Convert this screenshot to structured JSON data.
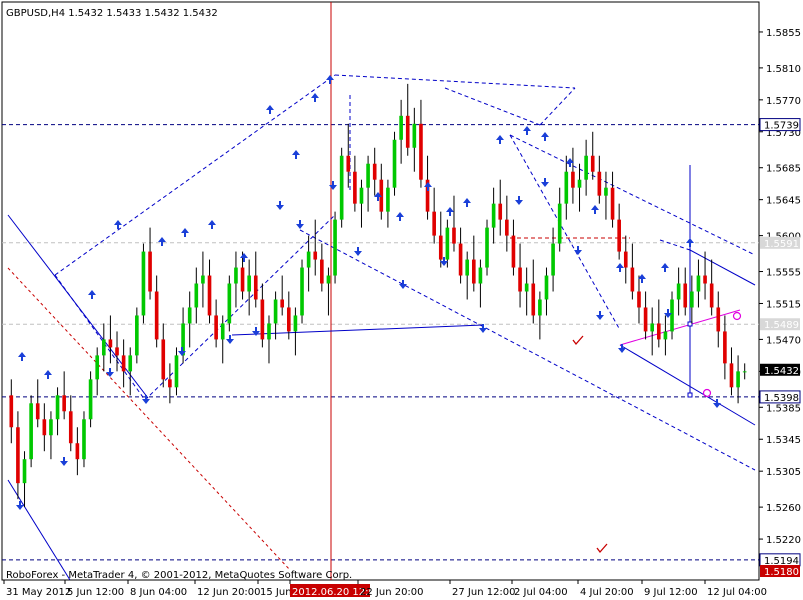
{
  "window": {
    "symbol_title": "GBPUSD,H4  1.5432 1.5433 1.5432 1.5432",
    "watermark": "RoboForex - MetaTrader 4, © 2001-2012, MetaQuotes Software Corp."
  },
  "colors": {
    "background": "#ffffff",
    "bull_candle": "#00c800",
    "bear_candle": "#e00000",
    "wick": "#000000",
    "trend_line": "#0000c8",
    "level_line": "#000080",
    "accent_red": "#c80000",
    "accent_magenta": "#e000e0",
    "axis_text": "#000000",
    "price_label_bg": "#000080"
  },
  "icons": [
    "arrow-up-icon",
    "arrow-down-icon",
    "checkmark-icon",
    "circle-marker-icon"
  ],
  "chart_data": {
    "type": "candlestick",
    "instrument": "GBPUSD",
    "timeframe": "H4",
    "current_price": 1.5432,
    "y_ticks": [
      "1.5855",
      "1.5810",
      "1.5770",
      "1.5730",
      "1.5685",
      "1.5645",
      "1.5600",
      "1.5555",
      "1.5515",
      "1.5470",
      "1.5430",
      "1.5385",
      "1.5345",
      "1.5305",
      "1.5260",
      "1.5220"
    ],
    "x_ticks": [
      "31 May 2012",
      "5 Jun 12:00",
      "8 Jun 04:00",
      "12 Jun 20:00",
      "15 Jun",
      "2012.06.20 12:00",
      "22 Jun 20:00",
      "27 Jun 12:00",
      "2 Jul 04:00",
      "4 Jul 20:00",
      "9 Jul 12:00",
      "12 Jul 04:00"
    ],
    "x_cursor_label": "2012.06.20 12:00",
    "price_labels": [
      {
        "text": "1.5739",
        "kind": "level"
      },
      {
        "text": "1.5591",
        "kind": "level_faded"
      },
      {
        "text": "1.5489",
        "kind": "level_faded"
      },
      {
        "text": "1.5432",
        "kind": "current"
      },
      {
        "text": "1.5398",
        "kind": "level"
      },
      {
        "text": "1.5194",
        "kind": "level"
      },
      {
        "text": "1.5180",
        "kind": "cursor"
      }
    ],
    "horizontal_levels": [
      1.5739,
      1.5591,
      1.5489,
      1.5398,
      1.5194
    ],
    "ylim": [
      1.5175,
      1.5885
    ],
    "candles": [
      [
        1.54,
        1.542,
        1.534,
        1.536
      ],
      [
        1.536,
        1.538,
        1.527,
        1.529
      ],
      [
        1.529,
        1.533,
        1.526,
        1.532
      ],
      [
        1.532,
        1.54,
        1.531,
        1.539
      ],
      [
        1.539,
        1.542,
        1.536,
        1.537
      ],
      [
        1.537,
        1.539,
        1.533,
        1.535
      ],
      [
        1.535,
        1.538,
        1.532,
        1.537
      ],
      [
        1.537,
        1.541,
        1.535,
        1.54
      ],
      [
        1.54,
        1.543,
        1.537,
        1.538
      ],
      [
        1.538,
        1.54,
        1.533,
        1.534
      ],
      [
        1.534,
        1.536,
        1.53,
        1.532
      ],
      [
        1.532,
        1.538,
        1.531,
        1.537
      ],
      [
        1.537,
        1.543,
        1.536,
        1.542
      ],
      [
        1.542,
        1.546,
        1.54,
        1.545
      ],
      [
        1.545,
        1.549,
        1.543,
        1.547
      ],
      [
        1.547,
        1.55,
        1.544,
        1.546
      ],
      [
        1.546,
        1.548,
        1.543,
        1.545
      ],
      [
        1.545,
        1.547,
        1.541,
        1.543
      ],
      [
        1.543,
        1.546,
        1.54,
        1.545
      ],
      [
        1.545,
        1.551,
        1.544,
        1.55
      ],
      [
        1.55,
        1.559,
        1.549,
        1.558
      ],
      [
        1.558,
        1.561,
        1.552,
        1.553
      ],
      [
        1.553,
        1.555,
        1.546,
        1.547
      ],
      [
        1.547,
        1.549,
        1.541,
        1.542
      ],
      [
        1.542,
        1.544,
        1.539,
        1.541
      ],
      [
        1.541,
        1.546,
        1.54,
        1.545
      ],
      [
        1.545,
        1.551,
        1.544,
        1.549
      ],
      [
        1.549,
        1.553,
        1.546,
        1.551
      ],
      [
        1.551,
        1.556,
        1.549,
        1.554
      ],
      [
        1.554,
        1.558,
        1.551,
        1.555
      ],
      [
        1.555,
        1.557,
        1.549,
        1.55
      ],
      [
        1.55,
        1.552,
        1.546,
        1.547
      ],
      [
        1.547,
        1.55,
        1.544,
        1.549
      ],
      [
        1.549,
        1.555,
        1.548,
        1.554
      ],
      [
        1.554,
        1.558,
        1.551,
        1.556
      ],
      [
        1.556,
        1.558,
        1.552,
        1.553
      ],
      [
        1.553,
        1.557,
        1.55,
        1.555
      ],
      [
        1.555,
        1.558,
        1.551,
        1.552
      ],
      [
        1.552,
        1.554,
        1.546,
        1.547
      ],
      [
        1.547,
        1.55,
        1.544,
        1.549
      ],
      [
        1.549,
        1.553,
        1.547,
        1.552
      ],
      [
        1.552,
        1.555,
        1.55,
        1.551
      ],
      [
        1.551,
        1.553,
        1.547,
        1.548
      ],
      [
        1.548,
        1.551,
        1.545,
        1.55
      ],
      [
        1.55,
        1.557,
        1.549,
        1.556
      ],
      [
        1.556,
        1.56,
        1.553,
        1.558
      ],
      [
        1.558,
        1.562,
        1.555,
        1.557
      ],
      [
        1.557,
        1.559,
        1.553,
        1.554
      ],
      [
        1.554,
        1.556,
        1.55,
        1.555
      ],
      [
        1.555,
        1.563,
        1.554,
        1.562
      ],
      [
        1.562,
        1.571,
        1.561,
        1.57
      ],
      [
        1.57,
        1.574,
        1.566,
        1.568
      ],
      [
        1.568,
        1.57,
        1.563,
        1.564
      ],
      [
        1.564,
        1.567,
        1.561,
        1.566
      ],
      [
        1.566,
        1.57,
        1.563,
        1.569
      ],
      [
        1.569,
        1.571,
        1.565,
        1.567
      ],
      [
        1.567,
        1.569,
        1.562,
        1.563
      ],
      [
        1.563,
        1.567,
        1.561,
        1.566
      ],
      [
        1.566,
        1.573,
        1.565,
        1.572
      ],
      [
        1.572,
        1.577,
        1.569,
        1.575
      ],
      [
        1.575,
        1.579,
        1.57,
        1.571
      ],
      [
        1.571,
        1.576,
        1.568,
        1.574
      ],
      [
        1.574,
        1.577,
        1.566,
        1.567
      ],
      [
        1.567,
        1.57,
        1.562,
        1.563
      ],
      [
        1.563,
        1.566,
        1.559,
        1.56
      ],
      [
        1.56,
        1.563,
        1.556,
        1.557
      ],
      [
        1.557,
        1.562,
        1.556,
        1.561
      ],
      [
        1.561,
        1.565,
        1.558,
        1.559
      ],
      [
        1.559,
        1.561,
        1.554,
        1.555
      ],
      [
        1.555,
        1.558,
        1.552,
        1.557
      ],
      [
        1.557,
        1.56,
        1.553,
        1.554
      ],
      [
        1.554,
        1.557,
        1.551,
        1.556
      ],
      [
        1.556,
        1.562,
        1.555,
        1.561
      ],
      [
        1.561,
        1.566,
        1.559,
        1.564
      ],
      [
        1.564,
        1.567,
        1.56,
        1.562
      ],
      [
        1.562,
        1.565,
        1.558,
        1.56
      ],
      [
        1.56,
        1.562,
        1.555,
        1.556
      ],
      [
        1.556,
        1.559,
        1.551,
        1.553
      ],
      [
        1.553,
        1.556,
        1.55,
        1.554
      ],
      [
        1.554,
        1.557,
        1.549,
        1.55
      ],
      [
        1.55,
        1.553,
        1.547,
        1.552
      ],
      [
        1.552,
        1.556,
        1.55,
        1.555
      ],
      [
        1.555,
        1.561,
        1.553,
        1.559
      ],
      [
        1.559,
        1.566,
        1.558,
        1.564
      ],
      [
        1.564,
        1.57,
        1.562,
        1.568
      ],
      [
        1.568,
        1.571,
        1.564,
        1.566
      ],
      [
        1.566,
        1.569,
        1.563,
        1.567
      ],
      [
        1.567,
        1.572,
        1.565,
        1.57
      ],
      [
        1.57,
        1.573,
        1.567,
        1.568
      ],
      [
        1.568,
        1.57,
        1.564,
        1.565
      ],
      [
        1.565,
        1.568,
        1.562,
        1.566
      ],
      [
        1.566,
        1.568,
        1.561,
        1.562
      ],
      [
        1.562,
        1.564,
        1.557,
        1.558
      ],
      [
        1.558,
        1.56,
        1.554,
        1.556
      ],
      [
        1.556,
        1.559,
        1.552,
        1.553
      ],
      [
        1.553,
        1.555,
        1.549,
        1.551
      ],
      [
        1.551,
        1.553,
        1.547,
        1.548
      ],
      [
        1.548,
        1.551,
        1.545,
        1.549
      ],
      [
        1.549,
        1.552,
        1.546,
        1.547
      ],
      [
        1.547,
        1.55,
        1.545,
        1.548
      ],
      [
        1.548,
        1.553,
        1.547,
        1.552
      ],
      [
        1.552,
        1.556,
        1.55,
        1.554
      ],
      [
        1.554,
        1.556,
        1.55,
        1.551
      ],
      [
        1.551,
        1.555,
        1.549,
        1.553
      ],
      [
        1.553,
        1.557,
        1.551,
        1.555
      ],
      [
        1.555,
        1.558,
        1.552,
        1.554
      ],
      [
        1.554,
        1.557,
        1.55,
        1.551
      ],
      [
        1.551,
        1.553,
        1.546,
        1.548
      ],
      [
        1.548,
        1.55,
        1.542,
        1.544
      ],
      [
        1.544,
        1.546,
        1.54,
        1.541
      ],
      [
        1.541,
        1.545,
        1.539,
        1.543
      ],
      [
        1.543,
        1.544,
        1.542,
        1.543
      ]
    ]
  }
}
